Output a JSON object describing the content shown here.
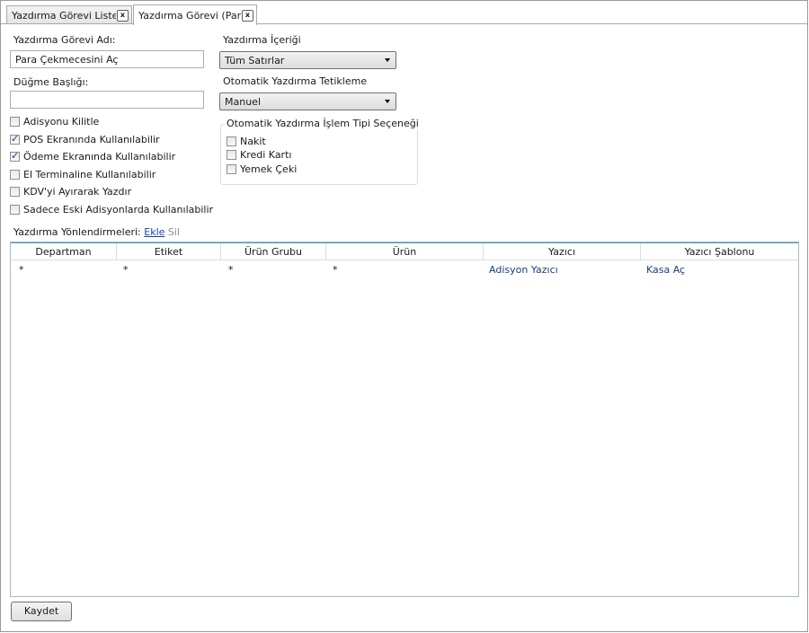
{
  "tabs": [
    {
      "label": "Yazdırma Görevi Liste"
    },
    {
      "label": "Yazdırma Görevi (Para"
    }
  ],
  "tab_close_label": "x",
  "form": {
    "name_label": "Yazdırma Görevi Adı:",
    "name_value": "Para Çekmecesini Aç",
    "button_title_label": "Düğme Başlığı:",
    "button_title_value": "",
    "content_label": "Yazdırma İçeriği",
    "content_value": "Tüm Satırlar",
    "trigger_label": "Otomatik Yazdırma Tetikleme",
    "trigger_value": "Manuel"
  },
  "checkboxes": [
    {
      "label": "Adisyonu Kilitle",
      "checked": false
    },
    {
      "label": "POS Ekranında Kullanılabilir",
      "checked": true
    },
    {
      "label": "Ödeme Ekranında Kullanılabilir",
      "checked": true
    },
    {
      "label": "El Terminaline Kullanılabilir",
      "checked": false
    },
    {
      "label": "KDV'yi Ayırarak Yazdır",
      "checked": false
    },
    {
      "label": "Sadece Eski Adisyonlarda Kullanılabilir",
      "checked": false
    }
  ],
  "payment_group": {
    "title": "Otomatik Yazdırma İşlem Tipi Seçeneği",
    "options": [
      {
        "label": "Nakit",
        "checked": false
      },
      {
        "label": "Kredi Kartı",
        "checked": false
      },
      {
        "label": "Yemek Çeki",
        "checked": false
      }
    ]
  },
  "mappings": {
    "label": "Yazdırma Yönlendirmeleri:",
    "add_link": "Ekle",
    "delete_link": "Sil",
    "columns": [
      "Departman",
      "Etiket",
      "Ürün Grubu",
      "Ürün",
      "Yazıcı",
      "Yazıcı Şablonu"
    ],
    "rows": [
      [
        "*",
        "*",
        "*",
        "*",
        "Adisyon Yazıcı",
        "Kasa Aç"
      ]
    ]
  },
  "save_button": "Kaydet"
}
